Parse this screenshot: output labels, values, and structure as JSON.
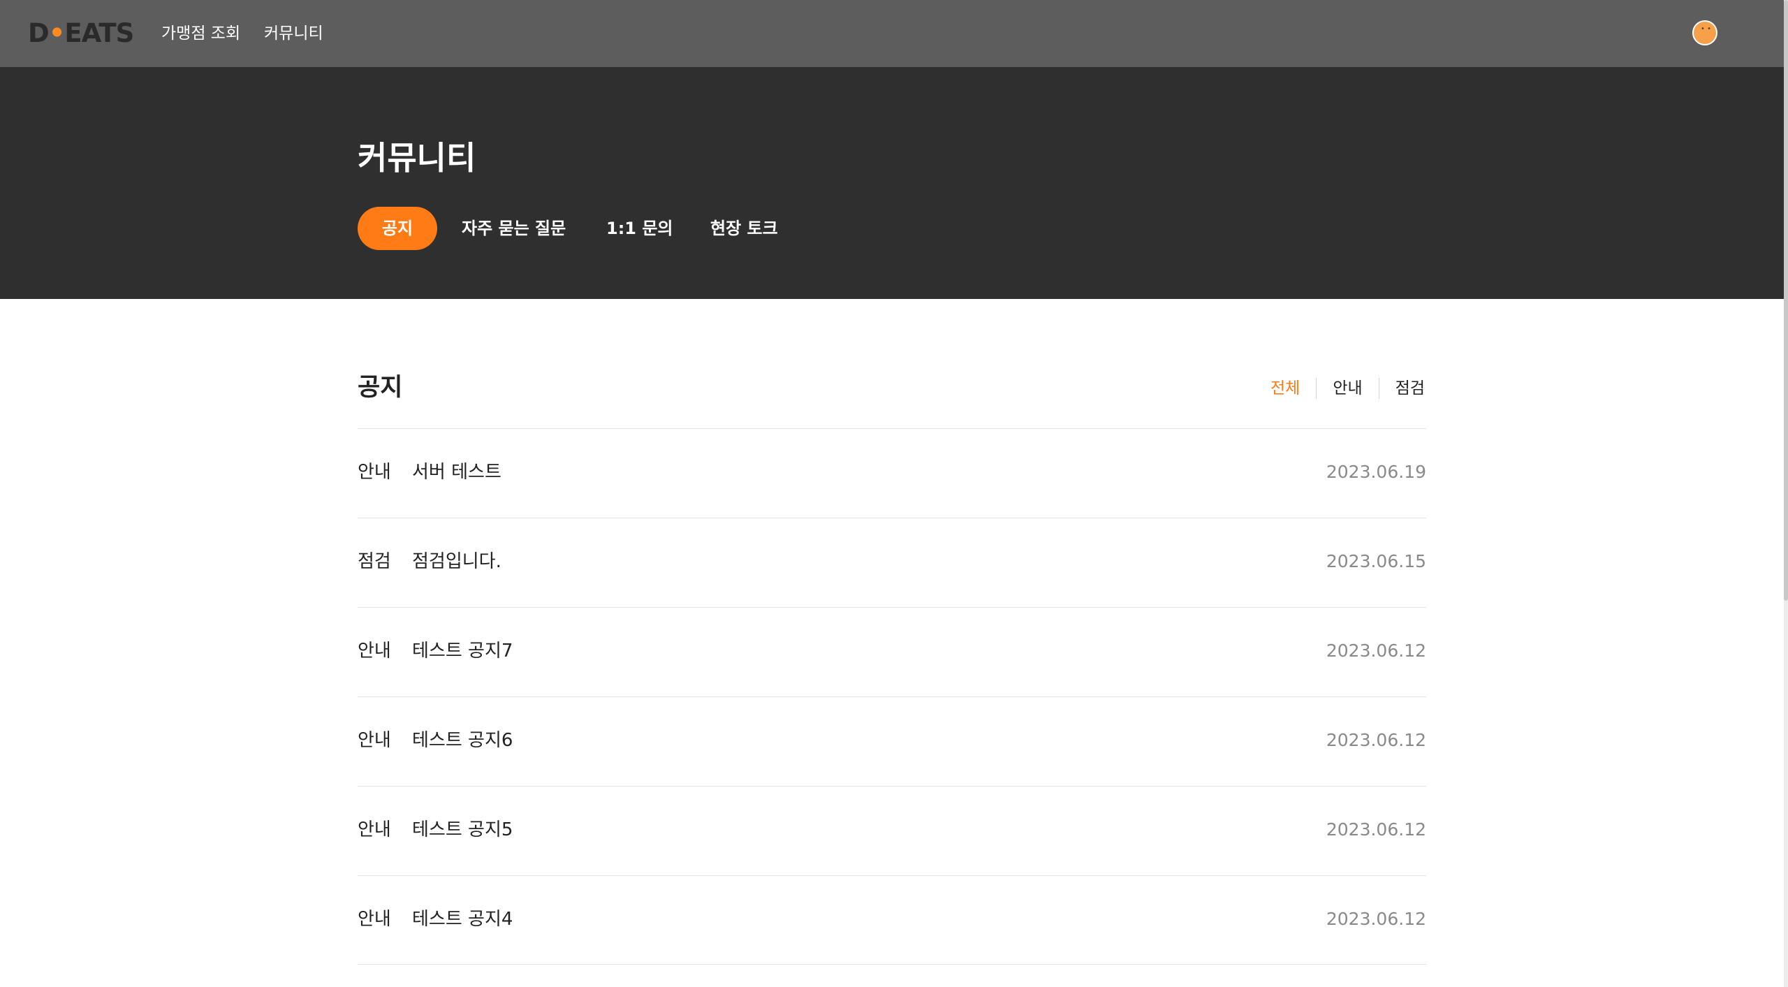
{
  "header": {
    "logo_text_left": "D",
    "logo_text_right": "EATS",
    "nav": [
      "가맹점 조회",
      "커뮤니티"
    ]
  },
  "hero": {
    "title": "커뮤니티",
    "tabs": [
      {
        "label": "공지",
        "active": true
      },
      {
        "label": "자주 묻는 질문",
        "active": false
      },
      {
        "label": "1:1 문의",
        "active": false
      },
      {
        "label": "현장 토크",
        "active": false
      }
    ]
  },
  "section": {
    "title": "공지",
    "filters": [
      {
        "label": "전체",
        "active": true
      },
      {
        "label": "안내",
        "active": false
      },
      {
        "label": "점검",
        "active": false
      }
    ]
  },
  "notices": [
    {
      "category": "안내",
      "title": "서버 테스트",
      "date": "2023.06.19"
    },
    {
      "category": "점검",
      "title": "점검입니다.",
      "date": "2023.06.15"
    },
    {
      "category": "안내",
      "title": "테스트 공지7",
      "date": "2023.06.12"
    },
    {
      "category": "안내",
      "title": "테스트 공지6",
      "date": "2023.06.12"
    },
    {
      "category": "안내",
      "title": "테스트 공지5",
      "date": "2023.06.12"
    },
    {
      "category": "안내",
      "title": "테스트 공지4",
      "date": "2023.06.12"
    }
  ],
  "colors": {
    "accent": "#ff7b16",
    "topbar": "#5d5d5d",
    "hero": "#2f2f2f"
  },
  "icons": {
    "avatar": "user-avatar-icon"
  }
}
